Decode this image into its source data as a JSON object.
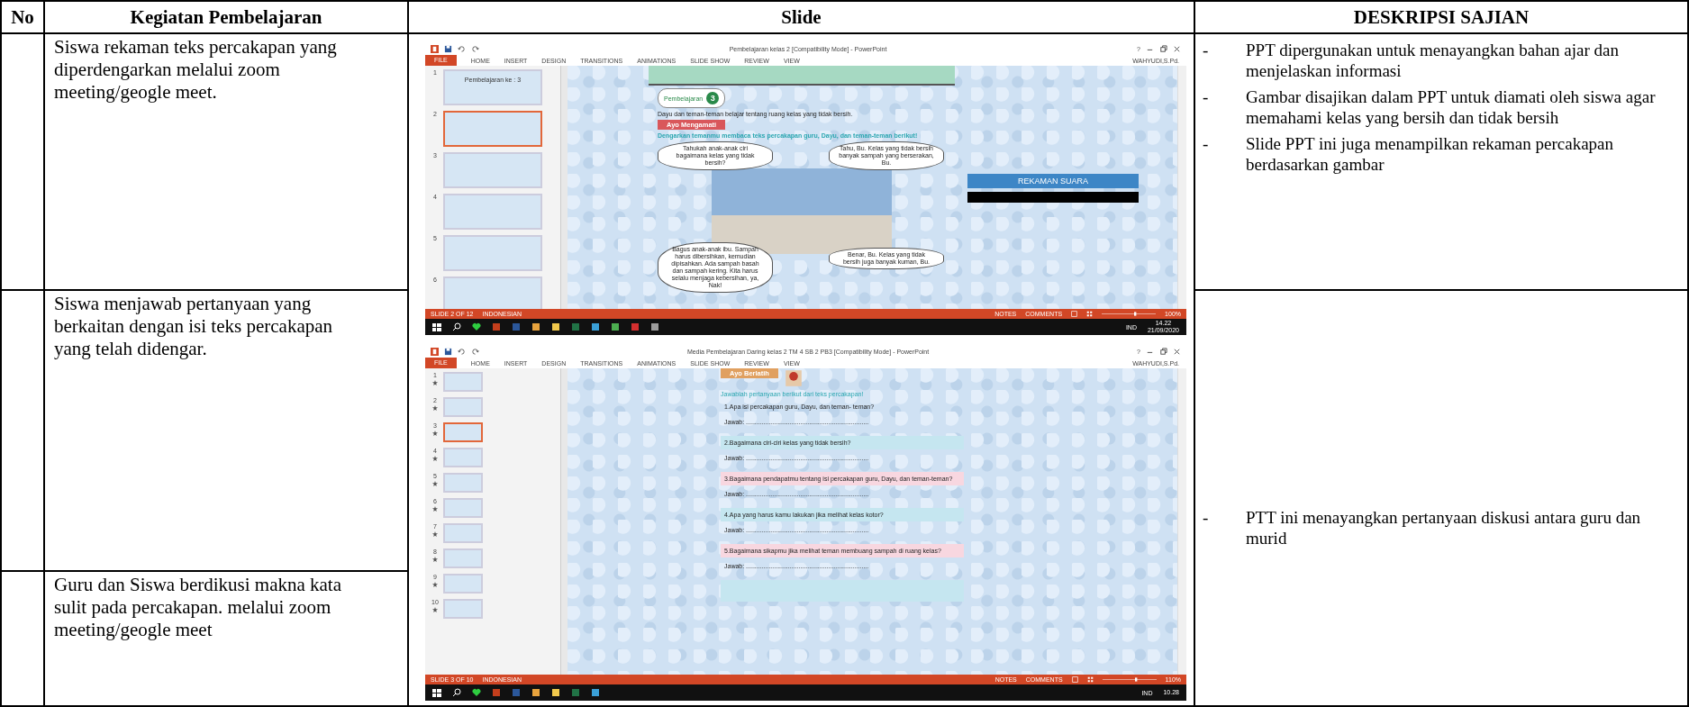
{
  "table": {
    "columns": [
      "No",
      "Kegiatan Pembelajaran",
      "Slide",
      "DESKRIPSI SAJIAN"
    ],
    "activities": [
      "Siswa rekaman teks percakapan yang diperdengarkan melalui zoom meeting/geogle meet.",
      "Siswa menjawab pertanyaan yang berkaitan dengan isi teks percakapan yang telah didengar.",
      "Guru dan Siswa berdikusi makna kata sulit pada percakapan. melalui zoom meeting/geogle meet"
    ],
    "descriptions": [
      {
        "items": [
          {
            "bullet": "-",
            "text": "PPT dipergunakan untuk menayangkan bahan ajar dan menjelaskan informasi"
          },
          {
            "bullet": "-",
            "text": "Gambar disajikan dalam PPT untuk diamati oleh siswa agar memahami kelas yang bersih dan tidak bersih"
          },
          {
            "bullet": "-",
            "text": "Slide PPT ini juga menampilkan rekaman percakapan berdasarkan gambar"
          }
        ]
      },
      {
        "items": [
          {
            "bullet": "-",
            "text": "PTT ini menayangkan pertanyaan diskusi antara guru dan murid"
          }
        ]
      }
    ],
    "screens": [
      {
        "app_title": "Pembelajaran kelas 2 [Compatibility Mode] - PowerPoint",
        "help": "?",
        "file_tab": "FILE",
        "tabs": [
          "HOME",
          "INSERT",
          "DESIGN",
          "TRANSITIONS",
          "ANIMATIONS",
          "SLIDE SHOW",
          "REVIEW",
          "VIEW"
        ],
        "user": "WAHYUDI,S.Pd.",
        "thumbnails": [
          {
            "number": "1",
            "selected": false,
            "caption": "Pembelajaran ke : 3"
          },
          {
            "number": "2",
            "selected": true
          },
          {
            "number": "3",
            "selected": false
          },
          {
            "number": "4",
            "selected": false
          },
          {
            "number": "5",
            "selected": false
          },
          {
            "number": "6",
            "selected": false
          }
        ],
        "slide": {
          "kind": "comic",
          "badge_label": "Pembelajaran",
          "badge_number": "3",
          "intro": "Dayu dan teman-teman belajar tentang ruang kelas  yang tidak bersih.",
          "section": "Ayo Mengamati",
          "instruction": "Dengarkan temanmu membaca teks percakapan  guru, Dayu, dan teman-teman berikut!",
          "bubbles": [
            "Tahukah anak-anak ciri bagaimana kelas yang tidak bersih?",
            "Tahu, Bu. Kelas yang tidak bersih banyak sampah yang berserakan, Bu.",
            "Bagus anak-anak ibu. Sampah harus dibersihkan, kemudian dipisahkan. Ada sampah basah dan sampah kering. Kita harus selalu menjaga kebersihan, ya, Nak!",
            "Benar, Bu. Kelas yang tidak bersih juga banyak kuman, Bu."
          ],
          "media_button": "REKAMAN SUARA"
        },
        "status": {
          "slide_count": "SLIDE 2 OF 12",
          "language": "INDONESIAN",
          "notes": "NOTES",
          "comments": "COMMENTS",
          "zoom": "100%"
        },
        "taskbar": {
          "language": "IND",
          "time": "14.22",
          "date": "21/09/2020"
        }
      },
      {
        "app_title": "Media Pembelajaran Daring  kelas 2 TM 4 SB 2 PB3 [Compatibility Mode] - PowerPoint",
        "help": "?",
        "file_tab": "FILE",
        "tabs": [
          "HOME",
          "INSERT",
          "DESIGN",
          "TRANSITIONS",
          "ANIMATIONS",
          "SLIDE SHOW",
          "REVIEW",
          "VIEW"
        ],
        "user": "WAHYUDI,S.Pd.",
        "thumbnails": [
          {
            "number": "1",
            "selected": false,
            "animated": true
          },
          {
            "number": "2",
            "selected": false,
            "animated": true
          },
          {
            "number": "3",
            "selected": true,
            "animated": true
          },
          {
            "number": "4",
            "selected": false,
            "animated": true
          },
          {
            "number": "5",
            "selected": false,
            "animated": true
          },
          {
            "number": "6",
            "selected": false,
            "animated": true
          },
          {
            "number": "7",
            "selected": false,
            "animated": true
          },
          {
            "number": "8",
            "selected": false,
            "animated": true
          },
          {
            "number": "9",
            "selected": false,
            "animated": true
          },
          {
            "number": "10",
            "selected": false,
            "animated": true
          }
        ],
        "slide": {
          "kind": "quiz",
          "section": "Ayo Berlatih",
          "instruction": "Jawablah pertanyaan berikut dari teks percakapan!",
          "questions": [
            {
              "text": "1.Apa isi percakapan guru, Dayu, dan teman-  teman?",
              "answer": "Jawab: ......................................................................"
            },
            {
              "text": "2.Bagaimana ciri-ciri kelas yang tidak bersih?",
              "answer": "Jawab: ......................................................................",
              "color": "#c5e6f0"
            },
            {
              "text": "3.Bagaimana pendapatmu tentang isi percakapan  guru, Dayu, dan teman-teman?",
              "answer": "Jawab: ......................................................................",
              "color": "#f8d7e0"
            },
            {
              "text": "4.Apa yang harus kamu lakukan jika melihat kelas  kotor?",
              "answer": "Jawab: ......................................................................",
              "color": "#c5e6f0"
            },
            {
              "text": "5.Bagaimana sikapmu jika melihat teman membuang sampah di ruang kelas?",
              "answer": "Jawab: ......................................................................",
              "color": "#f8d7e0"
            }
          ],
          "end_band": {
            "color": "#c5e6f0"
          }
        },
        "status": {
          "slide_count": "SLIDE 3 OF 10",
          "language": "INDONESIAN",
          "notes": "NOTES",
          "comments": "COMMENTS",
          "zoom": "110%"
        },
        "taskbar": {
          "language": "IND",
          "time": "10.28"
        }
      }
    ]
  }
}
